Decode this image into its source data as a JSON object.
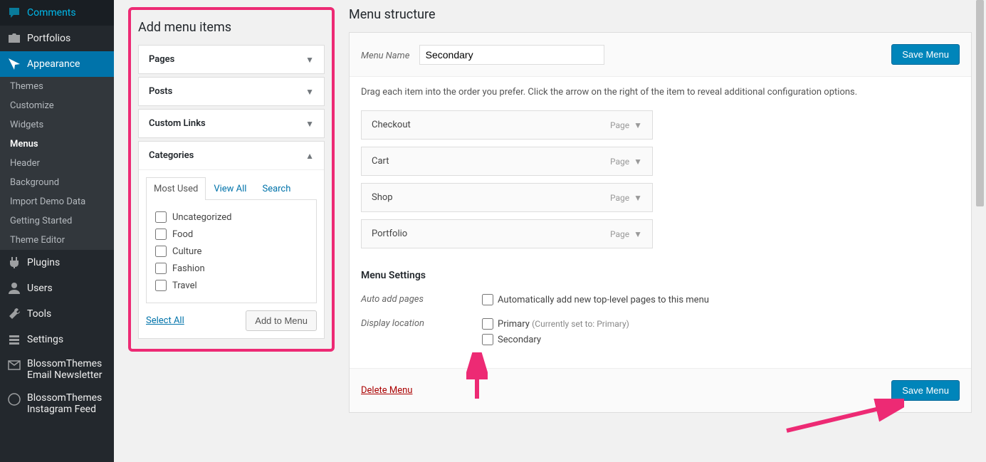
{
  "sidebar": {
    "items": [
      {
        "icon": "comments",
        "label": "Comments"
      },
      {
        "icon": "portfolio",
        "label": "Portfolios"
      },
      {
        "icon": "appearance",
        "label": "Appearance",
        "active": true,
        "sub": [
          {
            "label": "Themes"
          },
          {
            "label": "Customize"
          },
          {
            "label": "Widgets"
          },
          {
            "label": "Menus",
            "current": true
          },
          {
            "label": "Header"
          },
          {
            "label": "Background"
          },
          {
            "label": "Import Demo Data"
          },
          {
            "label": "Getting Started"
          },
          {
            "label": "Theme Editor"
          }
        ]
      },
      {
        "icon": "plugins",
        "label": "Plugins"
      },
      {
        "icon": "users",
        "label": "Users"
      },
      {
        "icon": "tools",
        "label": "Tools"
      },
      {
        "icon": "settings",
        "label": "Settings"
      },
      {
        "icon": "email",
        "label": "BlossomThemes Email Newsletter"
      },
      {
        "icon": "bt",
        "label": "BlossomThemes Instagram Feed"
      }
    ]
  },
  "addMenu": {
    "title": "Add menu items",
    "sections": [
      {
        "label": "Pages"
      },
      {
        "label": "Posts"
      },
      {
        "label": "Custom Links"
      },
      {
        "label": "Categories",
        "open": true
      }
    ],
    "tabs": [
      {
        "label": "Most Used",
        "active": true
      },
      {
        "label": "View All"
      },
      {
        "label": "Search"
      }
    ],
    "categories": [
      "Uncategorized",
      "Food",
      "Culture",
      "Fashion",
      "Travel"
    ],
    "selectAll": "Select All",
    "addBtn": "Add to Menu"
  },
  "structure": {
    "title": "Menu structure",
    "menuNameLabel": "Menu Name",
    "menuNameValue": "Secondary",
    "saveBtn": "Save Menu",
    "hint": "Drag each item into the order you prefer. Click the arrow on the right of the item to reveal additional configuration options.",
    "items": [
      {
        "label": "Checkout",
        "type": "Page"
      },
      {
        "label": "Cart",
        "type": "Page"
      },
      {
        "label": "Shop",
        "type": "Page"
      },
      {
        "label": "Portfolio",
        "type": "Page"
      }
    ],
    "settings": {
      "title": "Menu Settings",
      "autoAdd": {
        "label": "Auto add pages",
        "option": "Automatically add new top-level pages to this menu"
      },
      "display": {
        "label": "Display location",
        "primary": "Primary",
        "primaryNote": "(Currently set to: Primary)",
        "secondary": "Secondary"
      }
    },
    "deleteLink": "Delete Menu"
  }
}
